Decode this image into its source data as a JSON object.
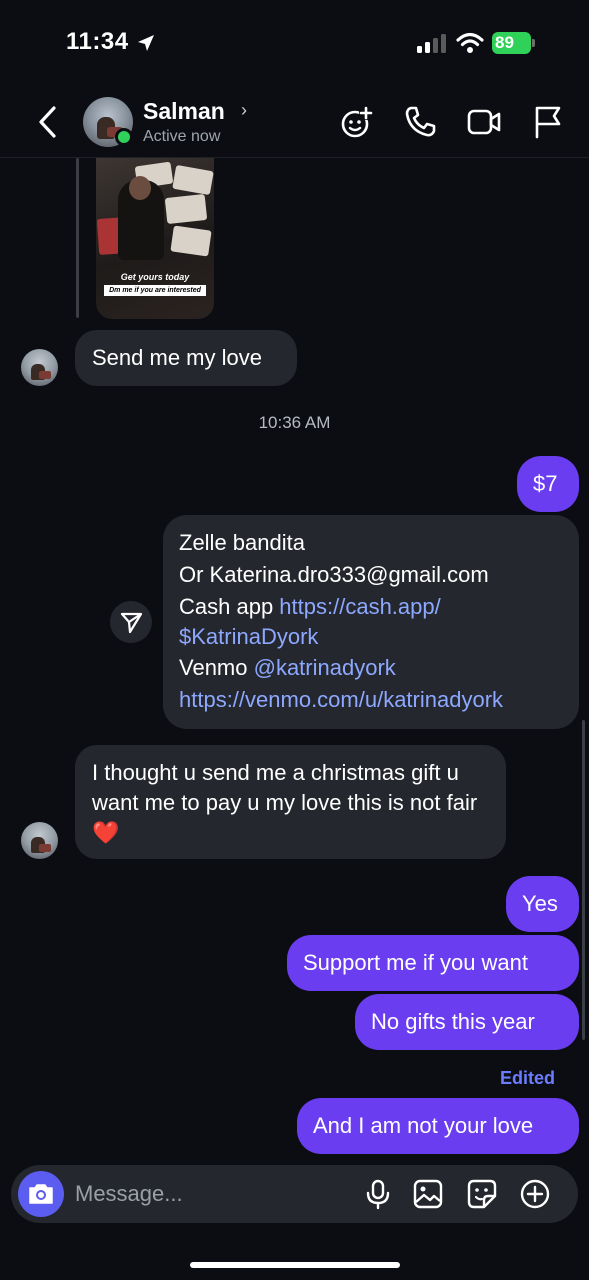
{
  "status_bar": {
    "time": "11:34",
    "battery": "89"
  },
  "header": {
    "name": "Salman",
    "status": "Active now"
  },
  "shared_story": {
    "line1": "Get yours today",
    "line2": "Dm me if you are interested"
  },
  "messages": {
    "in1": "Send me my love",
    "timestamp": "10:36 AM",
    "out_amount": "$7",
    "payment": {
      "line1": "Zelle bandita",
      "line2": "Or Katerina.dro333@gmail.com",
      "cash_label": "Cash app ",
      "cash_link1": "https://cash.app/",
      "cash_link2": "$KatrinaDyork",
      "venmo_label": "Venmo ",
      "venmo_handle": "@katrinadyork",
      "venmo_link": "https://venmo.com/u/katrinadyork"
    },
    "in2": "I thought u send me a christmas gift u want me to pay u my love this is not fair ❤️",
    "out_yes": "Yes",
    "out_support": "Support me if you want",
    "out_nogifts": "No gifts this year",
    "edited": "Edited",
    "out_notlove": "And I am not your love"
  },
  "composer": {
    "placeholder": "Message..."
  },
  "colors": {
    "background": "#0b0d12",
    "incoming": "#25272e",
    "outgoing": "#6a3ef0",
    "link": "#8da8ff",
    "camera": "#5b5cf0",
    "active": "#2fd15b"
  }
}
